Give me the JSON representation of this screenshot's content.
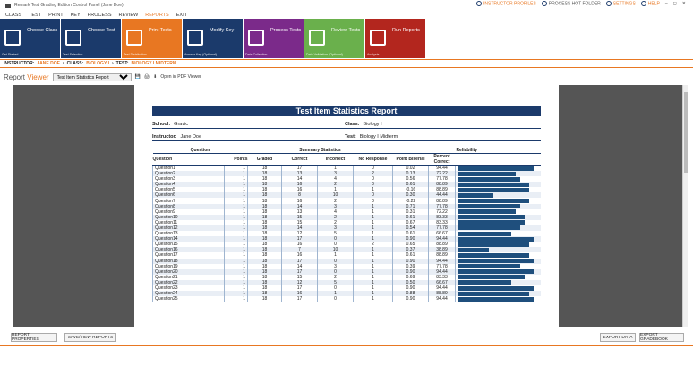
{
  "titlebar": {
    "text": "Remark Test Grading Edition Control Panel (Jane Doe)",
    "links": [
      "INSTRUCTOR PROFILES",
      "PROCESS HOT FOLDER",
      "SETTINGS",
      "HELP"
    ]
  },
  "menu": [
    "CLASS",
    "TEST",
    "PRINT",
    "KEY",
    "PROCESS",
    "REVIEW",
    "REPORTS",
    "EXIT"
  ],
  "tiles": [
    {
      "label": "Choose\nClass",
      "sub": "Get Started",
      "color": "#1b3a6b"
    },
    {
      "label": "Choose\nTest",
      "sub": "Test Selection",
      "color": "#1b3a6b"
    },
    {
      "label": "Print\nTests",
      "sub": "Test Distribution",
      "color": "#e87722"
    },
    {
      "label": "Modify\nKey",
      "sub": "Answer Key (Optional)",
      "color": "#1b3a6b"
    },
    {
      "label": "Process\nTests",
      "sub": "Data Collection",
      "color": "#7b2a8a"
    },
    {
      "label": "Review\nTests",
      "sub": "Data Validation (Optional)",
      "color": "#6ab04c"
    },
    {
      "label": "Run\nReports",
      "sub": "Analysis",
      "color": "#b3261e"
    }
  ],
  "bread": {
    "instructor_label": "INSTRUCTOR:",
    "instructor": "JANE DOE",
    "class_label": "CLASS:",
    "class": "BIOLOGY I",
    "test_label": "TEST:",
    "test": "BIOLOGY I MIDTERM"
  },
  "viewer": {
    "label1": "Report",
    "label2": "Viewer",
    "selected": "Test Item Statistics Report",
    "pdf": "Open in PDF Viewer"
  },
  "report": {
    "title": "Test Item Statistics Report",
    "school_label": "School:",
    "school": "Gravic",
    "class_label": "Class:",
    "class": "Biology I",
    "instructor_label": "Instructor:",
    "instructor": "Jane Doe",
    "test_label": "Test:",
    "test": "Biology I Midterm",
    "groups": {
      "question": "Question",
      "summary": "Summary Statistics",
      "reliability": "Reliability"
    },
    "cols": {
      "question": "Question",
      "points": "Points",
      "graded": "Graded",
      "correct": "Correct",
      "incorrect": "Incorrect",
      "noresp": "No Response",
      "pb": "Point Biserial",
      "pc": "Percent Correct"
    }
  },
  "chart_data": {
    "type": "table",
    "rows": [
      [
        "Question1",
        1,
        18,
        17,
        1,
        0,
        "0.02",
        "94.44"
      ],
      [
        "Question2",
        1,
        18,
        13,
        3,
        2,
        "0.13",
        "72.22"
      ],
      [
        "Question3",
        1,
        18,
        14,
        4,
        0,
        "0.56",
        "77.78"
      ],
      [
        "Question4",
        1,
        18,
        16,
        2,
        0,
        "0.61",
        "88.89"
      ],
      [
        "Question5",
        1,
        18,
        16,
        1,
        1,
        "-0.16",
        "88.89"
      ],
      [
        "Question6",
        1,
        18,
        8,
        10,
        0,
        "0.30",
        "44.44"
      ],
      [
        "Question7",
        1,
        18,
        16,
        2,
        0,
        "-0.22",
        "88.89"
      ],
      [
        "Question8",
        1,
        18,
        14,
        3,
        1,
        "0.71",
        "77.78"
      ],
      [
        "Question9",
        1,
        18,
        13,
        4,
        1,
        "0.31",
        "72.22"
      ],
      [
        "Question10",
        1,
        18,
        15,
        2,
        1,
        "0.61",
        "83.33"
      ],
      [
        "Question11",
        1,
        18,
        15,
        2,
        1,
        "0.67",
        "83.33"
      ],
      [
        "Question12",
        1,
        18,
        14,
        3,
        1,
        "0.54",
        "77.78"
      ],
      [
        "Question13",
        1,
        18,
        12,
        5,
        1,
        "0.61",
        "66.67"
      ],
      [
        "Question14",
        1,
        18,
        17,
        0,
        1,
        "0.90",
        "94.44"
      ],
      [
        "Question15",
        1,
        18,
        16,
        0,
        2,
        "0.65",
        "88.89"
      ],
      [
        "Question16",
        1,
        18,
        7,
        10,
        1,
        "0.37",
        "38.89"
      ],
      [
        "Question17",
        1,
        18,
        16,
        1,
        1,
        "0.61",
        "88.89"
      ],
      [
        "Question18",
        1,
        18,
        17,
        0,
        1,
        "0.90",
        "94.44"
      ],
      [
        "Question19",
        1,
        18,
        14,
        3,
        1,
        "0.39",
        "77.78"
      ],
      [
        "Question20",
        1,
        18,
        17,
        0,
        1,
        "0.90",
        "94.44"
      ],
      [
        "Question21",
        1,
        18,
        15,
        2,
        1,
        "0.69",
        "83.33"
      ],
      [
        "Question22",
        1,
        18,
        12,
        5,
        1,
        "0.50",
        "66.67"
      ],
      [
        "Question23",
        1,
        18,
        17,
        0,
        1,
        "0.90",
        "94.44"
      ],
      [
        "Question24",
        1,
        18,
        16,
        1,
        1,
        "0.88",
        "88.89"
      ],
      [
        "Question25",
        1,
        18,
        17,
        0,
        1,
        "0.90",
        "94.44"
      ]
    ]
  },
  "buttons": {
    "props": "REPORT PROPERTIES",
    "save": "SAVE/VIEW REPORTS",
    "export": "EXPORT DATA",
    "gradebook": "EXPORT GRADEBOOK"
  }
}
